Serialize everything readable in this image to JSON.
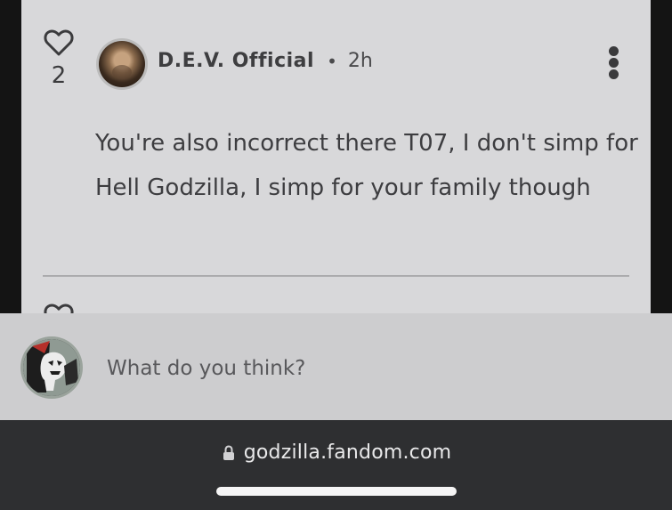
{
  "comment": {
    "like_count": "2",
    "author": "D.E.V. Official",
    "separator": "•",
    "timestamp": "2h",
    "body": "You're also incorrect there T07, I don't simp for Hell Godzilla, I simp for your family though",
    "icons": {
      "like": "heart-outline-icon",
      "more": "vertical-ellipsis-icon"
    }
  },
  "compose": {
    "placeholder": "What do you think?"
  },
  "browser": {
    "url": "godzilla.fandom.com",
    "icons": {
      "lock": "lock-icon"
    }
  },
  "colors": {
    "card_bg": "#d8d8da",
    "compose_bg": "#cdcdcf",
    "browser_bg": "#2e2f31",
    "text_primary": "#3d3d40"
  }
}
